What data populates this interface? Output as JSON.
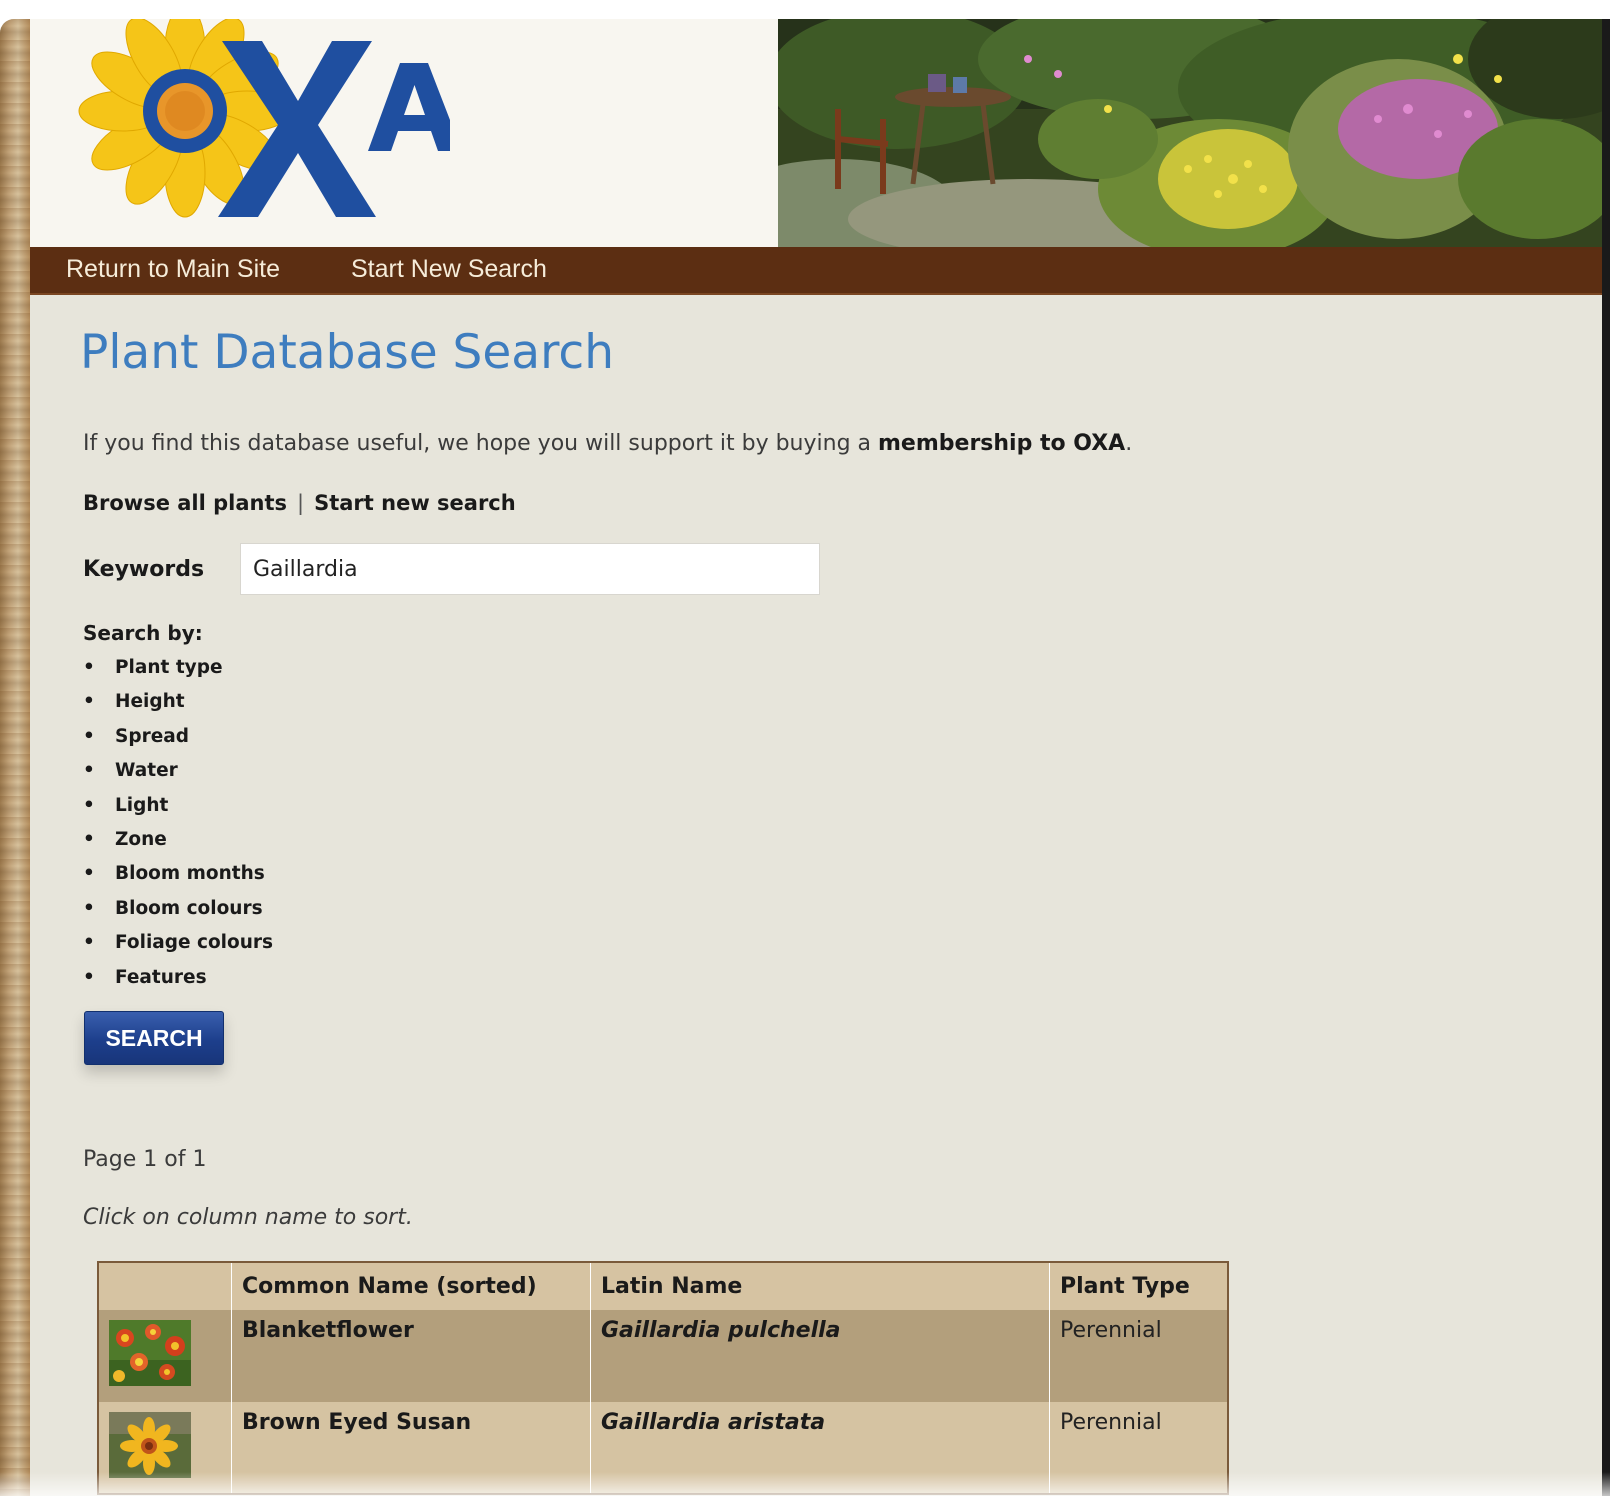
{
  "header": {
    "logo_text": "OXA"
  },
  "nav": {
    "return_label": "Return to Main Site",
    "new_search_label": "Start New Search"
  },
  "page": {
    "title": "Plant Database Search",
    "intro_prefix": "If you find this database useful, we hope you will support it by buying a ",
    "intro_link": "membership to OXA",
    "intro_suffix": ".",
    "browse_all": "Browse all plants",
    "separator": "|",
    "start_new": "Start new search"
  },
  "search": {
    "keywords_label": "Keywords",
    "keywords_value": "Gaillardia",
    "search_by_label": "Search by:",
    "criteria": [
      "Plant type",
      "Height",
      "Spread",
      "Water",
      "Light",
      "Zone",
      "Bloom months",
      "Bloom colours",
      "Foliage colours",
      "Features"
    ],
    "button_label": "SEARCH"
  },
  "results": {
    "page_info": "Page 1 of 1",
    "sort_hint": "Click on column name to sort.",
    "columns": [
      "",
      "Common Name (sorted)",
      "Latin Name",
      "Plant Type"
    ],
    "rows": [
      {
        "common_name": "Blanketflower",
        "latin_name": "Gaillardia pulchella",
        "plant_type": "Perennial"
      },
      {
        "common_name": "Brown Eyed Susan",
        "latin_name": "Gaillardia aristata",
        "plant_type": "Perennial"
      }
    ]
  },
  "colors": {
    "nav_bg": "#5c2e12",
    "title_blue": "#3e7dbf",
    "logo_blue": "#1f4fa0",
    "logo_yellow": "#f5c518",
    "button_blue": "#1d3f8c",
    "row_dark": "#b39f7c",
    "row_light": "#d5c3a2"
  }
}
